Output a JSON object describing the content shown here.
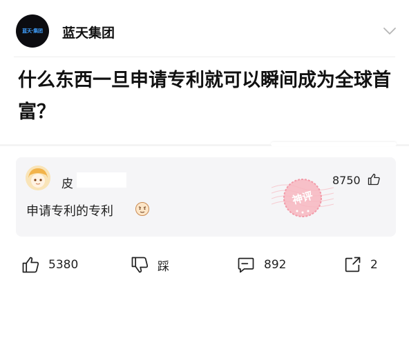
{
  "header": {
    "logo_text": "蓝天·集团",
    "account_name": "蓝天集团",
    "expand_icon": "chevron-down-icon"
  },
  "question": {
    "title": "什么东西一旦申请专利就可以瞬间成为全球首富？"
  },
  "comment": {
    "author": "皮",
    "likes": "8750",
    "text": "申请专利的专利",
    "stamp_text": "神评",
    "icons": {
      "like": "thumbs-up-icon",
      "emoji": "smile-emoji-icon",
      "stamp": "god-comment-stamp"
    }
  },
  "actions": {
    "like_count": "5380",
    "dislike_label": "踩",
    "comment_count": "892",
    "share_count": "2"
  },
  "colors": {
    "stamp": "#f29aa8",
    "logo_bg": "#0c0c10",
    "card_bg": "#f5f5f7"
  }
}
